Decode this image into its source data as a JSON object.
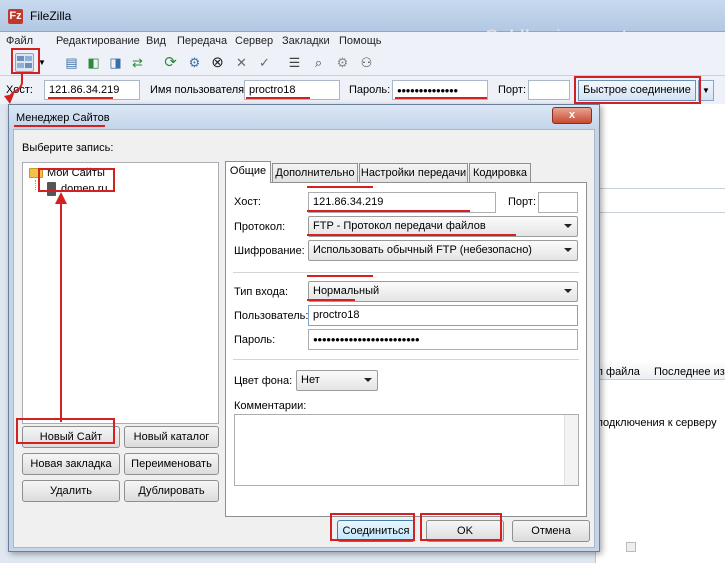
{
  "app": {
    "title": "FileZilla",
    "logo_letter": "Fz",
    "watermark": "Goldbusinessnet.com",
    "menu": [
      "Файл",
      "Редактирование",
      "Вид",
      "Передача",
      "Сервер",
      "Закладки",
      "Помощь"
    ]
  },
  "quickconnect": {
    "host_label": "Хост:",
    "host_value": "121.86.34.219",
    "user_label": "Имя пользователя",
    "user_value": "proctro18",
    "pass_label": "Пароль:",
    "pass_value": "●●●●●●●●●●●●●●",
    "port_label": "Порт:",
    "port_value": "",
    "connect_button": "Быстрое соединение",
    "dropdown_arrow": "▼"
  },
  "background_panel": {
    "col_file": "п файла",
    "col_last": "Последнее из",
    "status_text": "подключения к серверу"
  },
  "site_manager": {
    "title": "Менеджер Сайтов",
    "close_label": "x",
    "select_label": "Выберите запись:",
    "tree": {
      "root": "Мои Сайты",
      "site": "domen.ru"
    },
    "tabs": [
      "Общие",
      "Дополнительно",
      "Настройки передачи",
      "Кодировка"
    ],
    "general": {
      "host_label": "Хост:",
      "host_value": "121.86.34.219",
      "port_label": "Порт:",
      "port_value": "",
      "protocol_label": "Протокол:",
      "protocol_value": "FTP - Протокол передачи файлов",
      "encryption_label": "Шифрование:",
      "encryption_value": "Использовать обычный FTP (небезопасно)",
      "logon_label": "Тип входа:",
      "logon_value": "Нормальный",
      "user_label": "Пользователь:",
      "user_value": "proctro18",
      "pass_label": "Пароль:",
      "pass_value": "●●●●●●●●●●●●●●●●●●●●●●●●",
      "bgcolor_label": "Цвет фона:",
      "bgcolor_value": "Нет",
      "comments_label": "Комментарии:"
    },
    "buttons": {
      "new_site": "Новый Сайт",
      "new_folder": "Новый каталог",
      "new_bookmark": "Новая закладка",
      "rename": "Переименовать",
      "delete": "Удалить",
      "duplicate": "Дублировать",
      "connect": "Соединиться",
      "ok": "OK",
      "cancel": "Отмена"
    }
  },
  "colors": {
    "annotation_red": "#d32020",
    "window_frame": "#c4d5ea",
    "title_bar": "#b2c8e3"
  }
}
